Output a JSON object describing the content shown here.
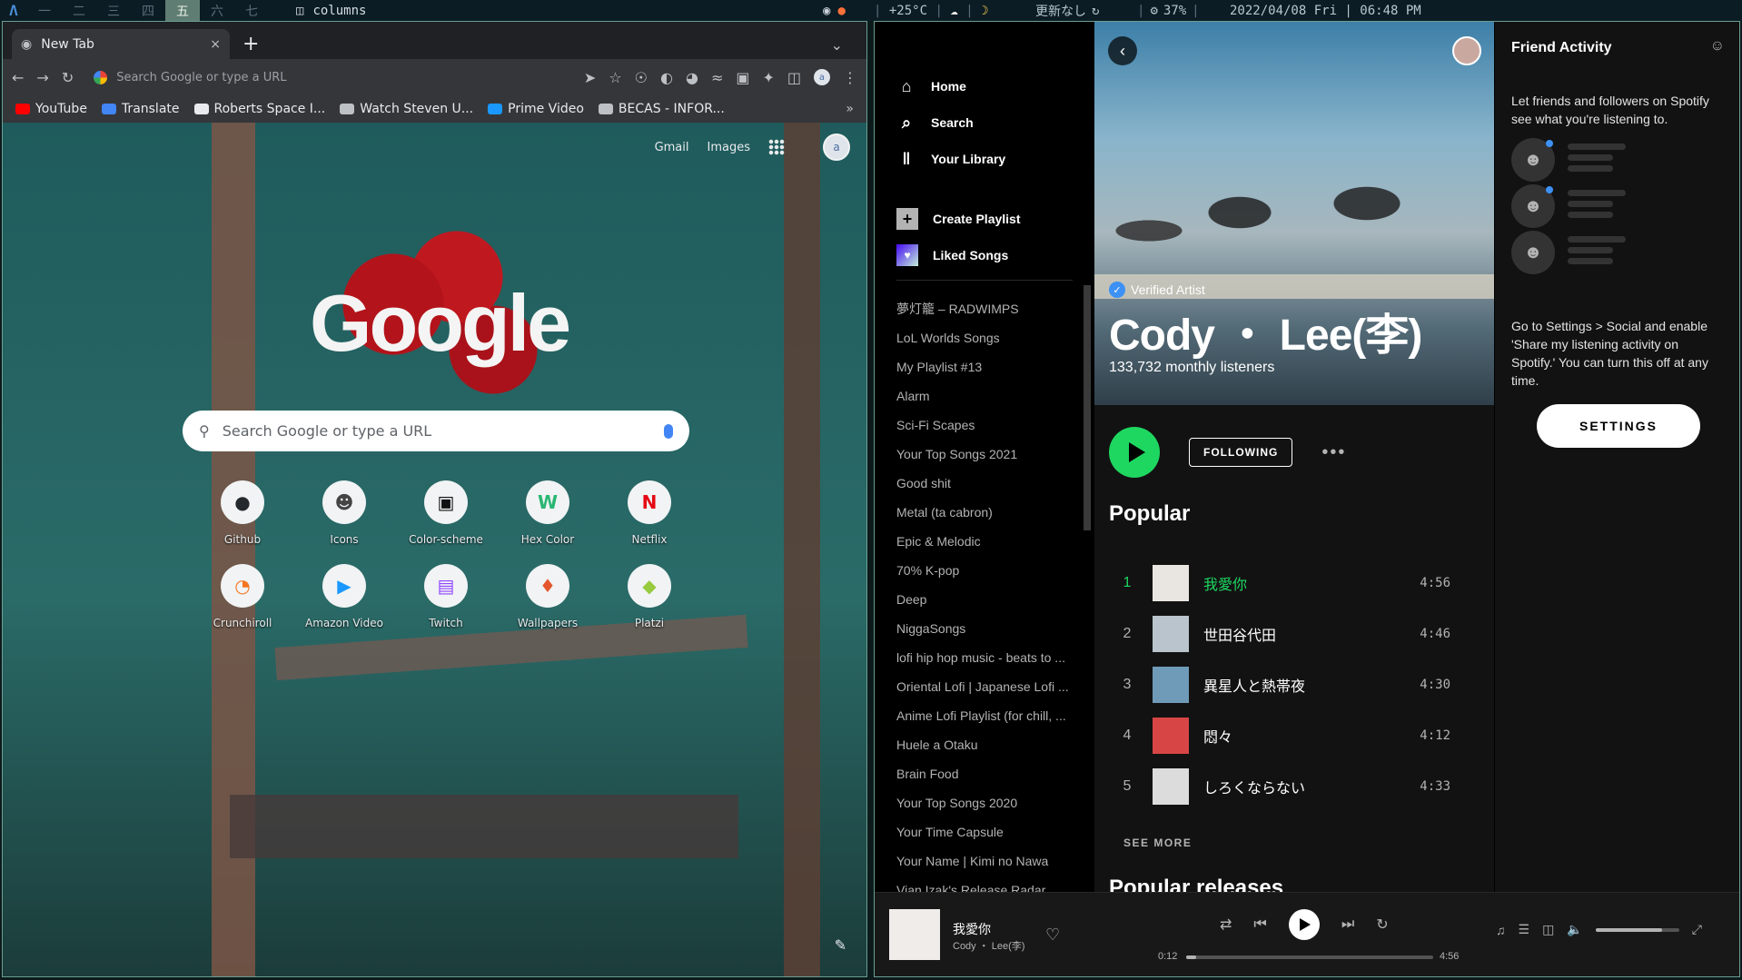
{
  "topbar": {
    "logo": "Λ",
    "workspaces": [
      "一",
      "二",
      "三",
      "四",
      "五",
      "六",
      "七"
    ],
    "active_workspace": 4,
    "layout_icon": "◫",
    "layout_label": "columns",
    "temperature": "+25°C",
    "update_status": "更新なし",
    "battery": "37%",
    "datetime": "2022/04/08 Fri | 06:48 PM"
  },
  "chrome": {
    "tab_title": "New Tab",
    "tab_close": "×",
    "new_tab": "+",
    "omnibox_placeholder": "Search Google or type a URL",
    "avatar_letter": "a",
    "bookmarks": [
      "YouTube",
      "Translate",
      "Roberts Space I...",
      "Watch Steven U...",
      "Prime Video",
      "BECAS - INFOR..."
    ],
    "bookmark_colors": [
      "#ff0000",
      "#4285f4",
      "#e8eaed",
      "#bdc1c6",
      "#1a98ff",
      "#bdc1c6"
    ],
    "bookmarks_more": "»",
    "ntp": {
      "gmail": "Gmail",
      "images": "Images",
      "logo": "Google",
      "search_placeholder": "Search Google or type a URL",
      "shortcuts": [
        {
          "label": "Github",
          "glyph": "●",
          "color": "#24292e"
        },
        {
          "label": "Icons",
          "glyph": "☻",
          "color": "#444"
        },
        {
          "label": "Color-scheme",
          "glyph": "▣",
          "color": "#111"
        },
        {
          "label": "Hex Color",
          "glyph": "W",
          "color": "#2bb673"
        },
        {
          "label": "Netflix",
          "glyph": "N",
          "color": "#e50914"
        },
        {
          "label": "Crunchiroll",
          "glyph": "◔",
          "color": "#f47521"
        },
        {
          "label": "Amazon Video",
          "glyph": "▶",
          "color": "#1a98ff"
        },
        {
          "label": "Twitch",
          "glyph": "▤",
          "color": "#9146ff"
        },
        {
          "label": "Wallpapers",
          "glyph": "♦",
          "color": "#e4572e"
        },
        {
          "label": "Platzi",
          "glyph": "◆",
          "color": "#98ca3f"
        }
      ]
    }
  },
  "spotify": {
    "nav": [
      {
        "icon": "home-icon",
        "glyph": "⌂",
        "label": "Home"
      },
      {
        "icon": "search-icon",
        "glyph": "⌕",
        "label": "Search"
      },
      {
        "icon": "library-icon",
        "glyph": "‖",
        "label": "Your Library"
      }
    ],
    "create_playlist": "Create Playlist",
    "liked_songs": "Liked Songs",
    "playlists": [
      "夢灯籠 – RADWIMPS",
      "LoL Worlds Songs",
      "My Playlist #13",
      "Alarm",
      "Sci-Fi Scapes",
      "Your Top Songs 2021",
      "Good shit",
      "Metal (ta cabron)",
      "Epic & Melodic",
      "70% K-pop",
      "Deep",
      "NiggaSongs",
      "lofi hip hop music - beats to ...",
      "Oriental Lofi | Japanese Lofi ...",
      "Anime Lofi Playlist (for chill, ...",
      "Huele a Otaku",
      "Brain Food",
      "Your Top Songs 2020",
      "Your Time Capsule",
      "Your Name | Kimi no Nawa",
      "Vian Izak's Release Radar"
    ],
    "artist": {
      "verified": "Verified Artist",
      "name": "Cody ・ Lee(李)",
      "listeners": "133,732 monthly listeners",
      "follow": "FOLLOWING",
      "more": "•••",
      "popular_title": "Popular",
      "tracks": [
        {
          "n": "1",
          "title": "我愛你",
          "dur": "4:56",
          "art": "#e9e5e1"
        },
        {
          "n": "2",
          "title": "世田谷代田",
          "dur": "4:46",
          "art": "#b9c4cc"
        },
        {
          "n": "3",
          "title": "異星人と熱帯夜",
          "dur": "4:30",
          "art": "#6f9bb8"
        },
        {
          "n": "4",
          "title": "悶々",
          "dur": "4:12",
          "art": "#d84545"
        },
        {
          "n": "5",
          "title": "しろくならない",
          "dur": "4:33",
          "art": "#dcdcdc"
        }
      ],
      "see_more": "SEE MORE",
      "releases_title": "Popular releases"
    },
    "friends": {
      "title": "Friend Activity",
      "intro": "Let friends and followers on Spotify see what you're listening to.",
      "note": "Go to Settings > Social and enable 'Share my listening activity on Spotify.' You can turn this off at any time.",
      "settings": "SETTINGS"
    },
    "player": {
      "title": "我愛你",
      "artist": "Cody ・ Lee(李)",
      "position": "0:12",
      "duration": "4:56",
      "progress": 0.04,
      "volume": 0.8
    }
  }
}
